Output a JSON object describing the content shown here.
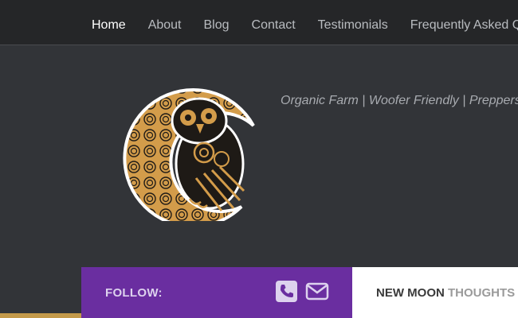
{
  "nav": {
    "items": [
      {
        "label": "Home",
        "active": true
      },
      {
        "label": "About",
        "active": false
      },
      {
        "label": "Blog",
        "active": false
      },
      {
        "label": "Contact",
        "active": false
      },
      {
        "label": "Testimonials",
        "active": false
      },
      {
        "label": "Frequently Asked Q",
        "active": false
      }
    ]
  },
  "header": {
    "tagline": "Organic Farm | Woofer Friendly | Preppers"
  },
  "follow": {
    "label": "FOLLOW:",
    "icons": [
      "phone-icon",
      "envelope-icon"
    ]
  },
  "moon_panel": {
    "title_bold": "NEW MOON",
    "title_light": "THOUGHTS"
  },
  "colors": {
    "background": "#323438",
    "topbar": "#252628",
    "purple": "#6a2ea0",
    "gold": "#d39c4a",
    "owl_dark": "#1e1a16"
  }
}
